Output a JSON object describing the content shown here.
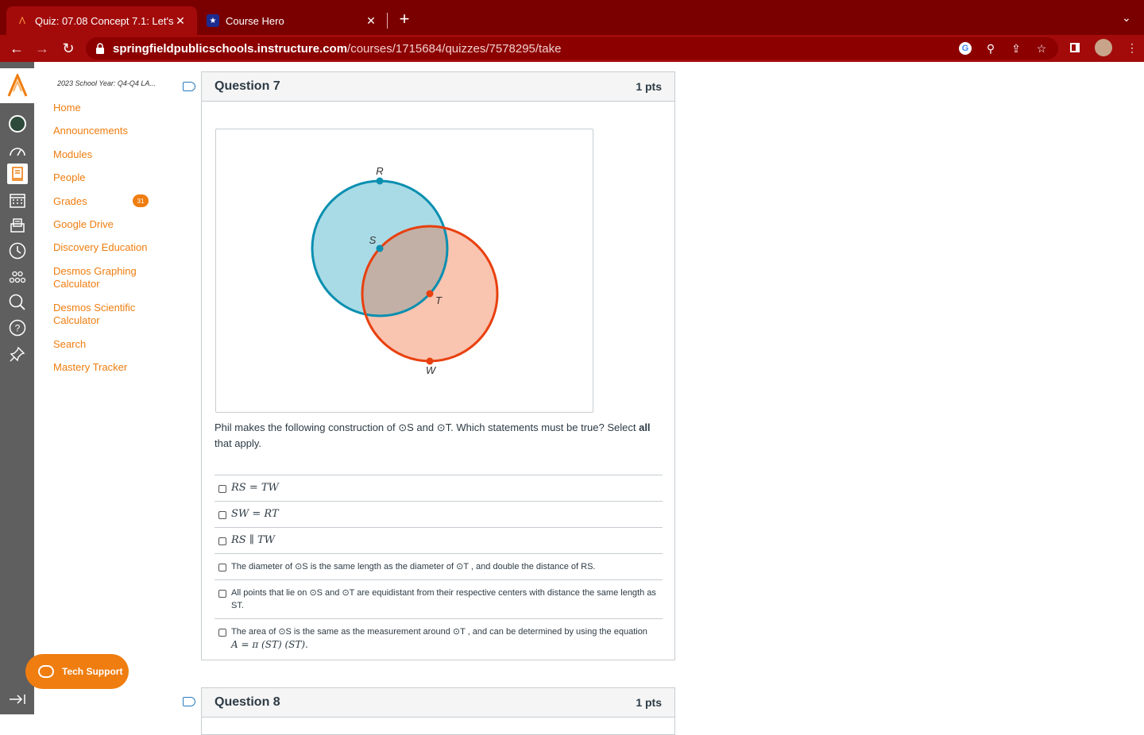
{
  "browser": {
    "tabs": [
      {
        "title": "Quiz: 07.08 Concept 7.1: Let's",
        "active": true
      },
      {
        "title": "Course Hero",
        "active": false
      }
    ],
    "url_host": "springfieldpublicschools.instructure.com",
    "url_path": "/courses/1715684/quizzes/7578295/take"
  },
  "course_nav": {
    "breadcrumb": "2023 School Year: Q4-Q4 LA...",
    "links": [
      "Home",
      "Announcements",
      "Modules",
      "People",
      "Grades",
      "Google Drive",
      "Discovery Education",
      "Desmos Graphing Calculator",
      "Desmos Scientific Calculator",
      "Search",
      "Mastery Tracker"
    ],
    "grades_badge": "31",
    "tech_support": "Tech Support"
  },
  "question7": {
    "title": "Question 7",
    "points": "1 pts",
    "figure": {
      "labels": {
        "r": "R",
        "s": "S",
        "t": "T",
        "w": "W"
      },
      "colors": {
        "circle_s": "#0a8fb0",
        "fill_s": "#a8dbe6",
        "circle_t": "#e8400f",
        "fill_t": "#f9c4b0",
        "overlap": "#c2b0a6"
      }
    },
    "prompt_before": "Phil makes the following construction of ⊙S and ⊙T. Which statements must be true? Select ",
    "prompt_bold": "all",
    "prompt_after": " that apply.",
    "answers": [
      "RS = TW",
      "SW = RT",
      "RS ∥ TW",
      "The diameter of ⊙S is the same length as the diameter of ⊙T , and double the distance of RS.",
      "All points that lie on ⊙S and ⊙T are equidistant from their respective centers with distance the same length as ST.",
      "The area of ⊙S is the same as the measurement around ⊙T , and can be determined by using the equation"
    ],
    "answer6_equation": "A = π (ST) (ST)."
  },
  "question8": {
    "title": "Question 8",
    "points": "1 pts"
  },
  "accent": "#ef7d0f"
}
